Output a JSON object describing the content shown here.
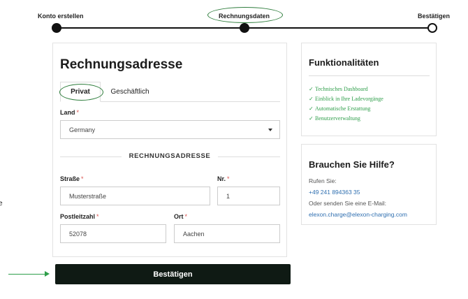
{
  "stepper": {
    "steps": [
      "Konto erstellen",
      "Rechnungsdaten",
      "Bestätigen"
    ],
    "current": "Rechnungsdaten"
  },
  "edge_glyph": "e",
  "form": {
    "title": "Rechnungsadresse",
    "tabs": [
      "Privat",
      "Geschäftlich"
    ],
    "active_tab": "Privat",
    "land": {
      "label": "Land",
      "value": "Germany",
      "required_mark": "*"
    },
    "section_title": "RECHNUNGSADRESSE",
    "strasse": {
      "label": "Straße",
      "value": "Musterstraße",
      "required_mark": "*"
    },
    "nr": {
      "label": "Nr.",
      "value": "1",
      "required_mark": "*"
    },
    "plz": {
      "label": "Postleitzahl",
      "value": "52078",
      "required_mark": "*"
    },
    "ort": {
      "label": "Ort",
      "value": "Aachen",
      "required_mark": "*"
    },
    "submit_label": "Bestätigen"
  },
  "features": {
    "title": "Funktionalitäten",
    "check_icon": "✓",
    "items": [
      "Technisches Dashboard",
      "Einblick in Ihre Ladevorgänge",
      "Automatische Erstattung",
      "Benutzerverwaltung"
    ]
  },
  "help": {
    "title": "Brauchen Sie Hilfe?",
    "call_label": "Rufen Sie:",
    "phone": "+49 241 894363 35",
    "email_label": "Oder senden Sie eine E-Mail:",
    "email": "elexon.charge@elexon-charging.com"
  },
  "colors": {
    "accent_green": "#2e9e4a",
    "annotation_green": "#2e7d3c",
    "button_dark": "#0f1a14",
    "link_blue": "#2f6fb0",
    "required_red": "#d9534f"
  }
}
